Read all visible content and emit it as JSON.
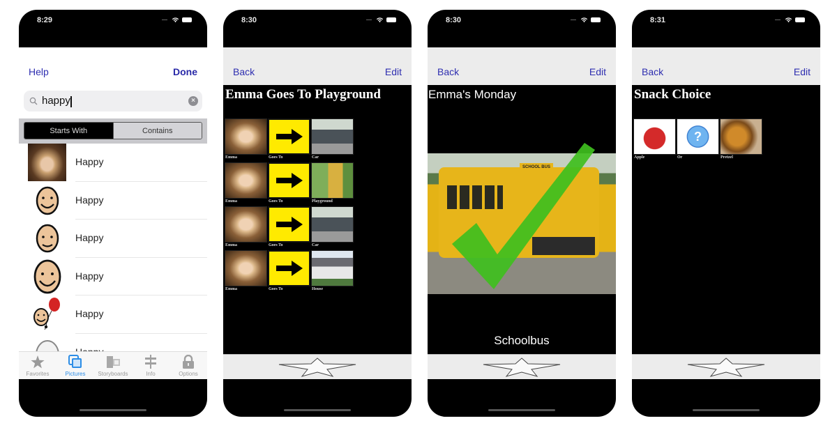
{
  "colors": {
    "nav_link": "#2e2eb0",
    "tab_active": "#2c8de6",
    "tab_inactive": "#999999",
    "sign_yellow": "#ffea00",
    "check_green": "#3fbf1e"
  },
  "phones": [
    {
      "status_time": "8:29",
      "nav": {
        "left": "Help",
        "right": "Done"
      },
      "search": {
        "value": "happy",
        "placeholder": ""
      },
      "segments": [
        {
          "label": "Starts With",
          "selected": true
        },
        {
          "label": "Contains",
          "selected": false
        }
      ],
      "results": [
        {
          "label": "Happy",
          "icon": "girl-photo"
        },
        {
          "label": "Happy",
          "icon": "smiley-face-icon"
        },
        {
          "label": "Happy",
          "icon": "smiley-face-icon"
        },
        {
          "label": "Happy",
          "icon": "smiley-face-icon"
        },
        {
          "label": "Happy",
          "icon": "smiley-balloon-icon"
        },
        {
          "label": "Happy",
          "icon": "smiley-outline-icon"
        }
      ],
      "tabs": [
        {
          "label": "Favorites",
          "icon": "star-icon",
          "active": false
        },
        {
          "label": "Pictures",
          "icon": "pictures-icon",
          "active": true
        },
        {
          "label": "Storyboards",
          "icon": "storyboards-icon",
          "active": false
        },
        {
          "label": "Info",
          "icon": "signpost-icon",
          "active": false
        },
        {
          "label": "Options",
          "icon": "lock-icon",
          "active": false
        }
      ]
    },
    {
      "status_time": "8:30",
      "nav": {
        "left": "Back",
        "right": "Edit"
      },
      "title": "Emma Goes To Playground",
      "rows": [
        {
          "cells": [
            {
              "caption": "Emma",
              "image": "girl"
            },
            {
              "caption": "Goes To",
              "image": "arrow"
            },
            {
              "caption": "Car",
              "image": "car"
            }
          ]
        },
        {
          "cells": [
            {
              "caption": "Emma",
              "image": "girl"
            },
            {
              "caption": "Goes To",
              "image": "arrow"
            },
            {
              "caption": "Playground",
              "image": "playground"
            }
          ]
        },
        {
          "cells": [
            {
              "caption": "Emma",
              "image": "girl"
            },
            {
              "caption": "Goes To",
              "image": "arrow"
            },
            {
              "caption": "Car",
              "image": "car"
            }
          ]
        },
        {
          "cells": [
            {
              "caption": "Emma",
              "image": "girl"
            },
            {
              "caption": "Goes To",
              "image": "arrow"
            },
            {
              "caption": "House",
              "image": "house"
            }
          ]
        }
      ]
    },
    {
      "status_time": "8:30",
      "nav": {
        "left": "Back",
        "right": "Edit"
      },
      "title": "Emma's Monday",
      "bus_sign": "SCHOOL BUS",
      "caption": "Schoolbus"
    },
    {
      "status_time": "8:31",
      "nav": {
        "left": "Back",
        "right": "Edit"
      },
      "title": "Snack Choice",
      "cells": [
        {
          "caption": "Apple",
          "image": "apple"
        },
        {
          "caption": "Or",
          "image": "question"
        },
        {
          "caption": "Pretzel",
          "image": "pretzel"
        }
      ]
    }
  ]
}
